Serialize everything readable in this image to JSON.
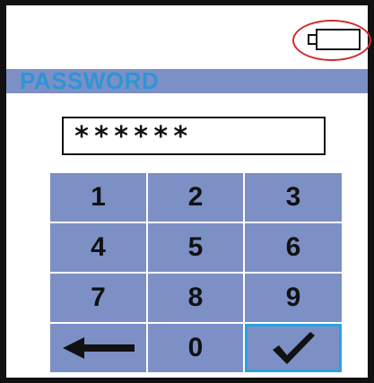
{
  "title": "PASSWORD",
  "password_field": {
    "value": "******"
  },
  "keypad": {
    "digits": [
      "1",
      "2",
      "3",
      "4",
      "5",
      "6",
      "7",
      "8",
      "9",
      "0"
    ]
  },
  "icons": {
    "battery": "battery-empty-icon",
    "backspace": "left-arrow-icon",
    "confirm": "checkmark-icon"
  },
  "colors": {
    "key_fill": "#7c90c6",
    "title_text": "#2e95d6",
    "highlight_ring": "#d22a2a",
    "confirm_border": "#2aa3dc"
  }
}
